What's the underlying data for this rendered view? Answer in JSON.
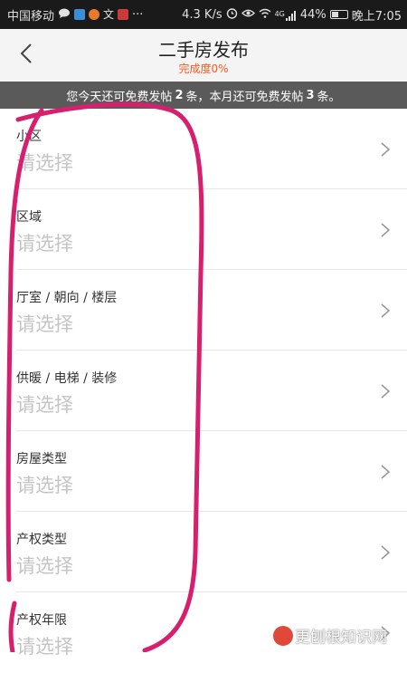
{
  "status_bar": {
    "carrier": "中国移动",
    "speed": "4.3 K/s",
    "network": "4G",
    "battery": "44%",
    "battery_level": 0.44,
    "time": "晚上7:05",
    "more": "···"
  },
  "header": {
    "title": "二手房发布",
    "completion": "完成度0%"
  },
  "notice": {
    "text_before": "您今天还可免费发帖",
    "daily_count": "2",
    "text_middle": "条，本月还可免费发帖",
    "monthly_count": "3",
    "text_after": "条。"
  },
  "form": {
    "fields": [
      {
        "label": "小区",
        "placeholder": "请选择"
      },
      {
        "label": "区域",
        "placeholder": "请选择"
      },
      {
        "label": "厅室 / 朝向 / 楼层",
        "placeholder": "请选择"
      },
      {
        "label": "供暖 / 电梯 / 装修",
        "placeholder": "请选择"
      },
      {
        "label": "房屋类型",
        "placeholder": "请选择"
      },
      {
        "label": "产权类型",
        "placeholder": "请选择"
      },
      {
        "label": "产权年限",
        "placeholder": "请选择"
      }
    ]
  },
  "colors": {
    "accent": "#ff5a1f",
    "annotation": "#d6206e",
    "notice_bg": "#5a5a5a"
  },
  "watermark": {
    "text": "更刨根知识网"
  }
}
